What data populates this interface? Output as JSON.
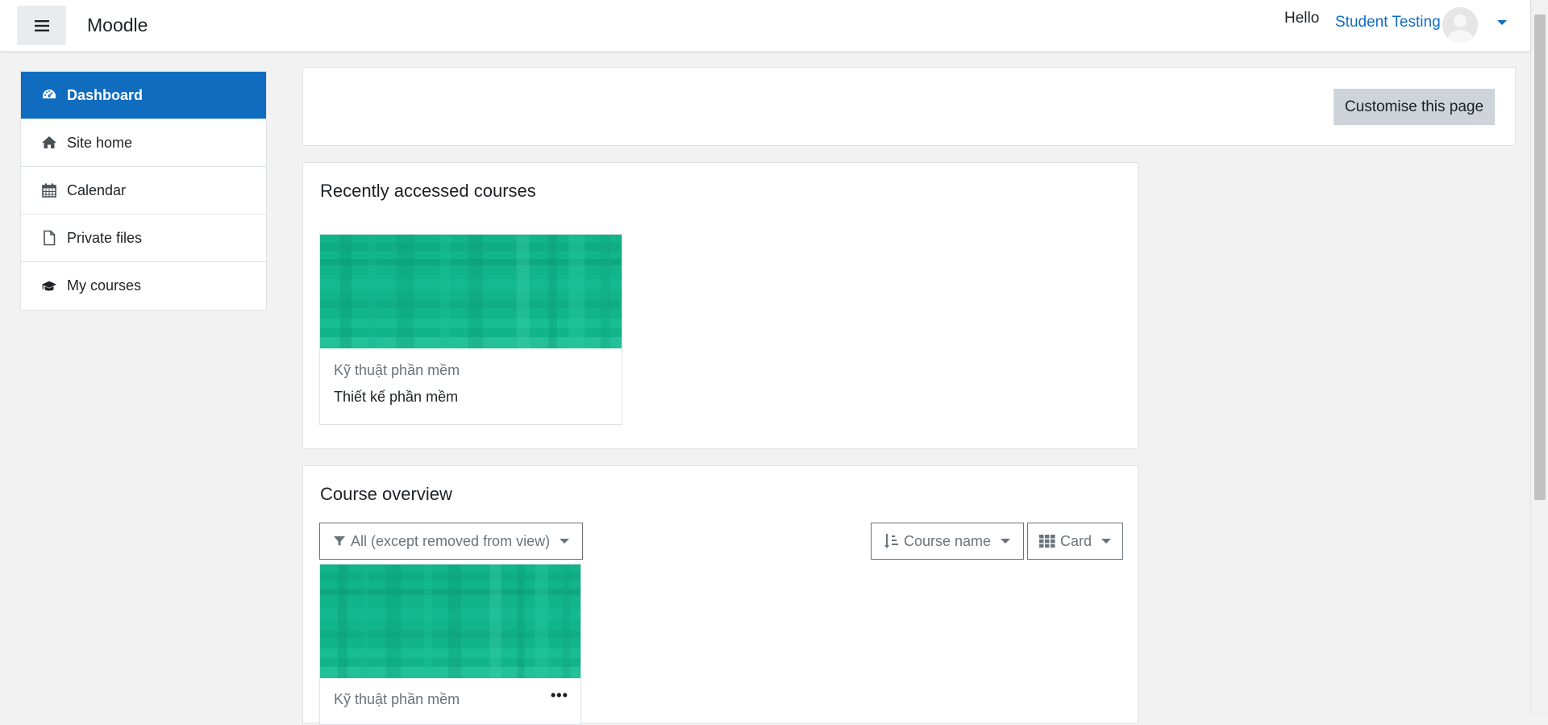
{
  "navbar": {
    "brand": "Moodle",
    "greeting": "Hello",
    "user_name": "Student Testing"
  },
  "sidebar": {
    "items": [
      {
        "label": "Dashboard",
        "icon": "dashboard-icon",
        "active": true
      },
      {
        "label": "Site home",
        "icon": "home-icon"
      },
      {
        "label": "Calendar",
        "icon": "calendar-icon"
      },
      {
        "label": "Private files",
        "icon": "file-icon"
      },
      {
        "label": "My courses",
        "icon": "graduation-cap-icon"
      }
    ]
  },
  "header": {
    "customise_label": "Customise this page"
  },
  "recent": {
    "title": "Recently accessed courses",
    "courses": [
      {
        "category": "Kỹ thuật phần mềm",
        "name": "Thiết kế phần mềm"
      }
    ]
  },
  "overview": {
    "title": "Course overview",
    "filter_label": "All (except removed from view)",
    "sort_label": "Course name",
    "view_label": "Card",
    "courses": [
      {
        "category": "Kỹ thuật phần mềm",
        "menu": "•••"
      }
    ]
  },
  "colors": {
    "primary": "#0f6cbf",
    "course_image": "#12b48a",
    "button_secondary": "#ced4da"
  }
}
